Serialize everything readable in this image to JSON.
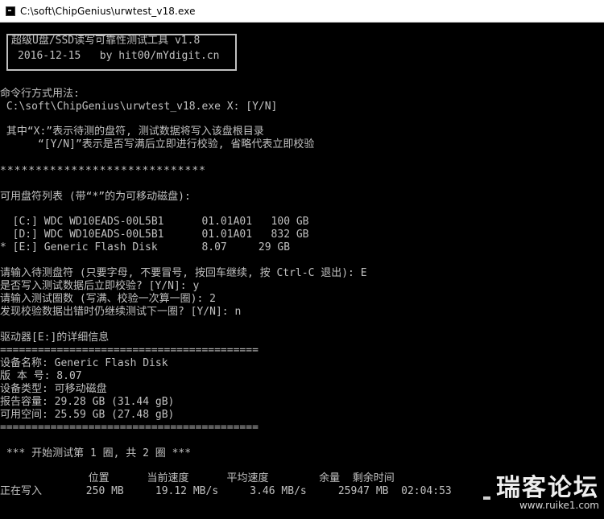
{
  "window": {
    "title": "C:\\soft\\ChipGenius\\urwtest_v18.exe"
  },
  "banner": {
    "line1": "超级U盘/SSD读写可靠性测试工具 v1.8",
    "line2": "2016-12-15   by hit00/mYdigit.cn"
  },
  "usage": {
    "heading": "命令行方式用法:",
    "command": " C:\\soft\\ChipGenius\\urwtest_v18.exe X: [Y/N]",
    "note1": " 其中“X:”表示待测的盘符, 测试数据将写入该盘根目录",
    "note2": "      “[Y/N]”表示是否写满后立即进行校验, 省略代表立即校验"
  },
  "separator_stars": "*****************************",
  "drives": {
    "heading": "可用盘符列表 (带“*”的为可移动磁盘):",
    "items": [
      "  [C:] WDC WD10EADS-00L5B1      01.01A01   100 GB",
      "  [D:] WDC WD10EADS-00L5B1      01.01A01   832 GB",
      "* [E:] Generic Flash Disk       8.07     29 GB"
    ]
  },
  "prompts": [
    "请输入待测盘符 (只要字母, 不要冒号, 按回车继续, 按 Ctrl-C 退出): E",
    "是否写入测试数据后立即校验? [Y/N]: y",
    "请输入测试圈数 (写满、校验一次算一圈): 2",
    "发现校验数据出错时仍继续测试下一圈? [Y/N]: n"
  ],
  "details": {
    "heading": "驱动器[E:]的详细信息",
    "rule": "=========================================",
    "rows": [
      "设备名称: Generic Flash Disk",
      "版 本 号: 8.07",
      "设备类型: 可移动磁盘",
      "报告容量: 29.28 GB (31.44 gB)",
      "可用空间: 25.59 GB (27.48 gB)"
    ]
  },
  "test": {
    "header": " *** 开始测试第 1 圈, 共 2 圈 ***",
    "columns": "              位置      当前速度      平均速度        余量  剩余时间",
    "status": "正在写入       250 MB     19.12 MB/s     3.46 MB/s     25947 MB  02:04:53"
  },
  "watermark": {
    "main": "瑞客论坛",
    "sub": "www.ruike1.com"
  }
}
